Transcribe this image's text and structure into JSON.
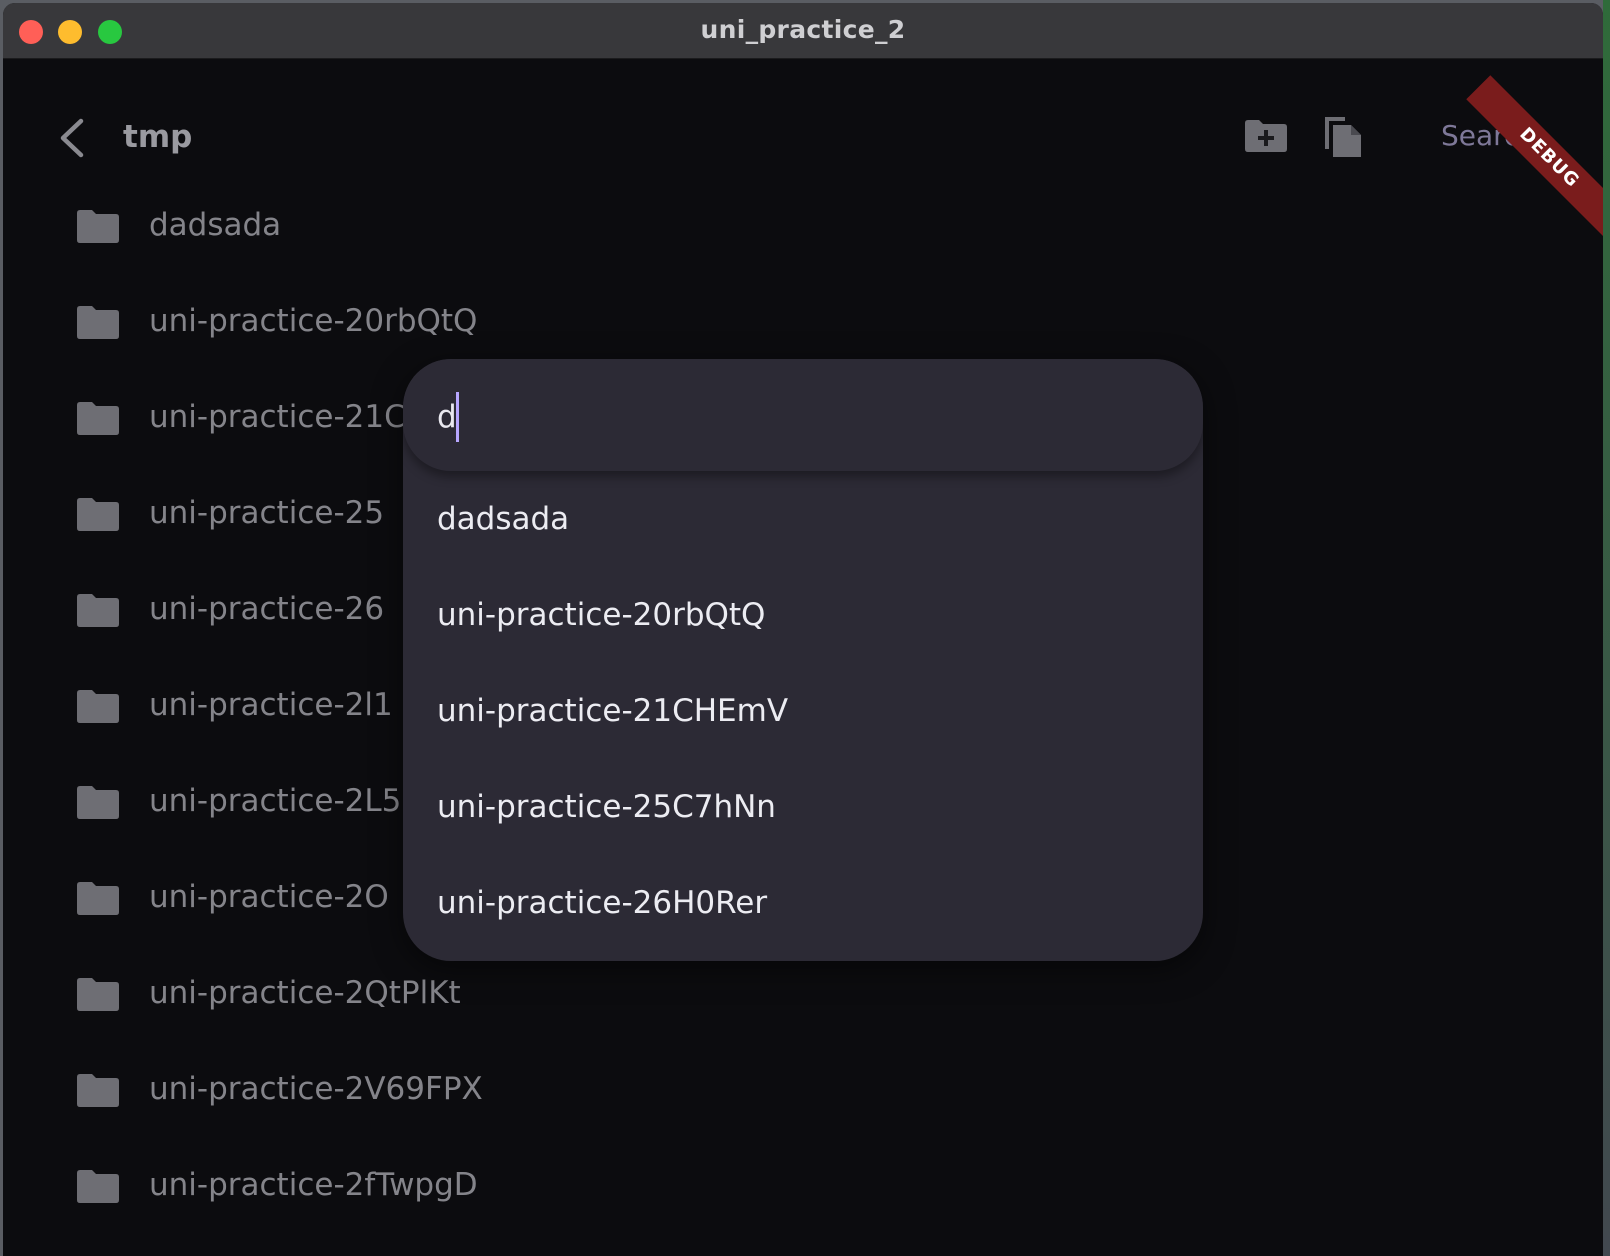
{
  "window": {
    "title": "uni_practice_2"
  },
  "appbar": {
    "path": "tmp",
    "search_label": "Search",
    "debug_banner": "DEBUG"
  },
  "files": [
    {
      "name": "dadsada"
    },
    {
      "name": "uni-practice-20rbQtQ"
    },
    {
      "name": "uni-practice-21C"
    },
    {
      "name": "uni-practice-25"
    },
    {
      "name": "uni-practice-26"
    },
    {
      "name": "uni-practice-2l1"
    },
    {
      "name": "uni-practice-2L5"
    },
    {
      "name": "uni-practice-2O"
    },
    {
      "name": "uni-practice-2QtPlKt"
    },
    {
      "name": "uni-practice-2V69FPX"
    },
    {
      "name": "uni-practice-2fTwpgD"
    }
  ],
  "search_popup": {
    "query": "d",
    "suggestions": [
      "dadsada",
      "uni-practice-20rbQtQ",
      "uni-practice-21CHEmV",
      "uni-practice-25C7hNn",
      "uni-practice-26H0Rer"
    ]
  },
  "colors": {
    "background": "#0c0c0f",
    "popup": "#2c2a35",
    "accent": "#b7a6ff"
  }
}
